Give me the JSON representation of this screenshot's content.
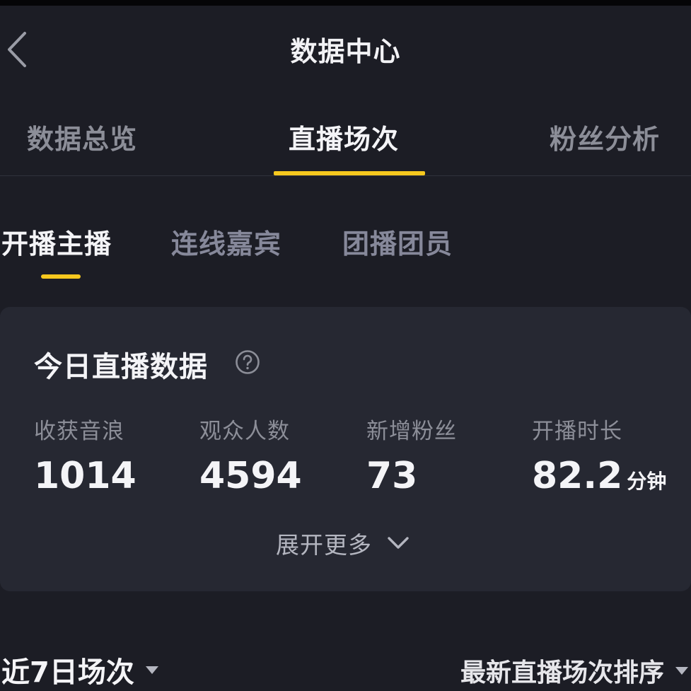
{
  "header": {
    "title": "数据中心",
    "back_icon": "chevron-left-icon"
  },
  "main_tabs": [
    {
      "label": "数据总览",
      "active": false
    },
    {
      "label": "直播场次",
      "active": true
    },
    {
      "label": "粉丝分析",
      "active": false
    }
  ],
  "sub_tabs": [
    {
      "label": "开播主播",
      "active": true
    },
    {
      "label": "连线嘉宾",
      "active": false
    },
    {
      "label": "团播团员",
      "active": false
    }
  ],
  "today_card": {
    "title": "今日直播数据",
    "help_icon": "question-circle-icon",
    "stats": [
      {
        "label": "收获音浪",
        "value": "1014",
        "unit": ""
      },
      {
        "label": "观众人数",
        "value": "4594",
        "unit": ""
      },
      {
        "label": "新增粉丝",
        "value": "73",
        "unit": ""
      },
      {
        "label": "开播时长",
        "value": "82.2",
        "unit": "分钟"
      }
    ],
    "expand_label": "展开更多",
    "expand_icon": "chevron-down-icon"
  },
  "footer": {
    "range_label": "近7日场次",
    "sort_label": "最新直播场次排序"
  },
  "colors": {
    "background": "#1c1d25",
    "card": "#262832",
    "accent": "#f6c81e",
    "text_primary": "#f4f4f7",
    "text_secondary": "#8c8e98"
  }
}
